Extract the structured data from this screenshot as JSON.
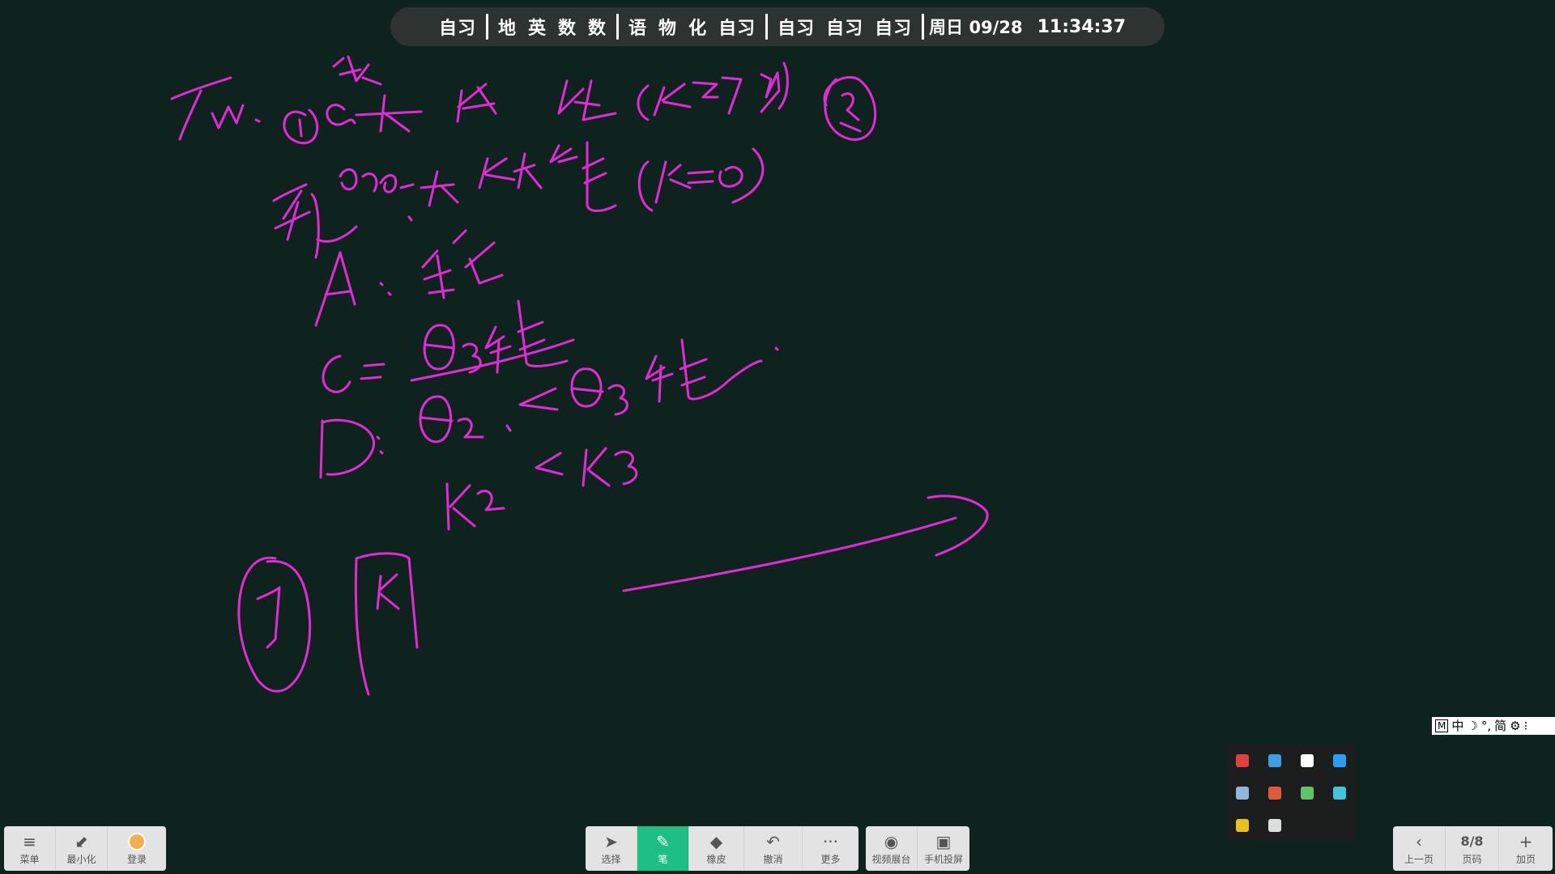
{
  "schedule": {
    "group1": [
      "自习"
    ],
    "group2": [
      "地",
      "英",
      "数",
      "数"
    ],
    "group3": [
      "语",
      "物",
      "化",
      "自习"
    ],
    "group4": [
      "自习",
      "自习",
      "自习"
    ],
    "date": "周日 09/28",
    "time": "11:34:37"
  },
  "ink": {
    "color": "#e32ad6"
  },
  "ime": {
    "items": [
      "M",
      "中",
      "☽",
      "°,",
      "简",
      "⚙",
      "⁝"
    ]
  },
  "tray": {
    "icons": [
      {
        "name": "qq-icon",
        "color": "#e04040"
      },
      {
        "name": "screen-icon",
        "color": "#3aa0e0"
      },
      {
        "name": "grid-app-icon",
        "color": "#ffffff"
      },
      {
        "name": "l-app-icon",
        "color": "#2a9df4"
      },
      {
        "name": "network-icon",
        "color": "#8fb7d9"
      },
      {
        "name": "volume-icon",
        "color": "#e05a3a"
      },
      {
        "name": "security-icon",
        "color": "#5cc56a"
      },
      {
        "name": "cloud-icon",
        "color": "#3fc6d9"
      },
      {
        "name": "user-app-icon",
        "color": "#e8c020"
      },
      {
        "name": "display-icon",
        "color": "#dddddd"
      }
    ]
  },
  "left_bar": [
    {
      "id": "menu",
      "label": "菜单",
      "icon": "≡"
    },
    {
      "id": "minimize",
      "label": "最小化",
      "icon": "⬋"
    },
    {
      "id": "login",
      "label": "登录",
      "icon": ""
    }
  ],
  "center_bar": [
    {
      "id": "select",
      "label": "选择",
      "icon": "➤"
    },
    {
      "id": "pen",
      "label": "笔",
      "icon": "✎"
    },
    {
      "id": "eraser",
      "label": "橡皮",
      "icon": "◆"
    },
    {
      "id": "undo",
      "label": "撤消",
      "icon": "↶"
    },
    {
      "id": "more",
      "label": "更多",
      "icon": "···"
    }
  ],
  "media_bar": [
    {
      "id": "video",
      "label": "视频展台",
      "icon": "◉"
    },
    {
      "id": "cast",
      "label": "手机投屏",
      "icon": "▣"
    }
  ],
  "page_bar": {
    "prev": {
      "label": "上一页",
      "icon": "‹"
    },
    "page": {
      "label": "页码",
      "value": "8/8"
    },
    "add": {
      "label": "加页",
      "icon": "+"
    }
  }
}
